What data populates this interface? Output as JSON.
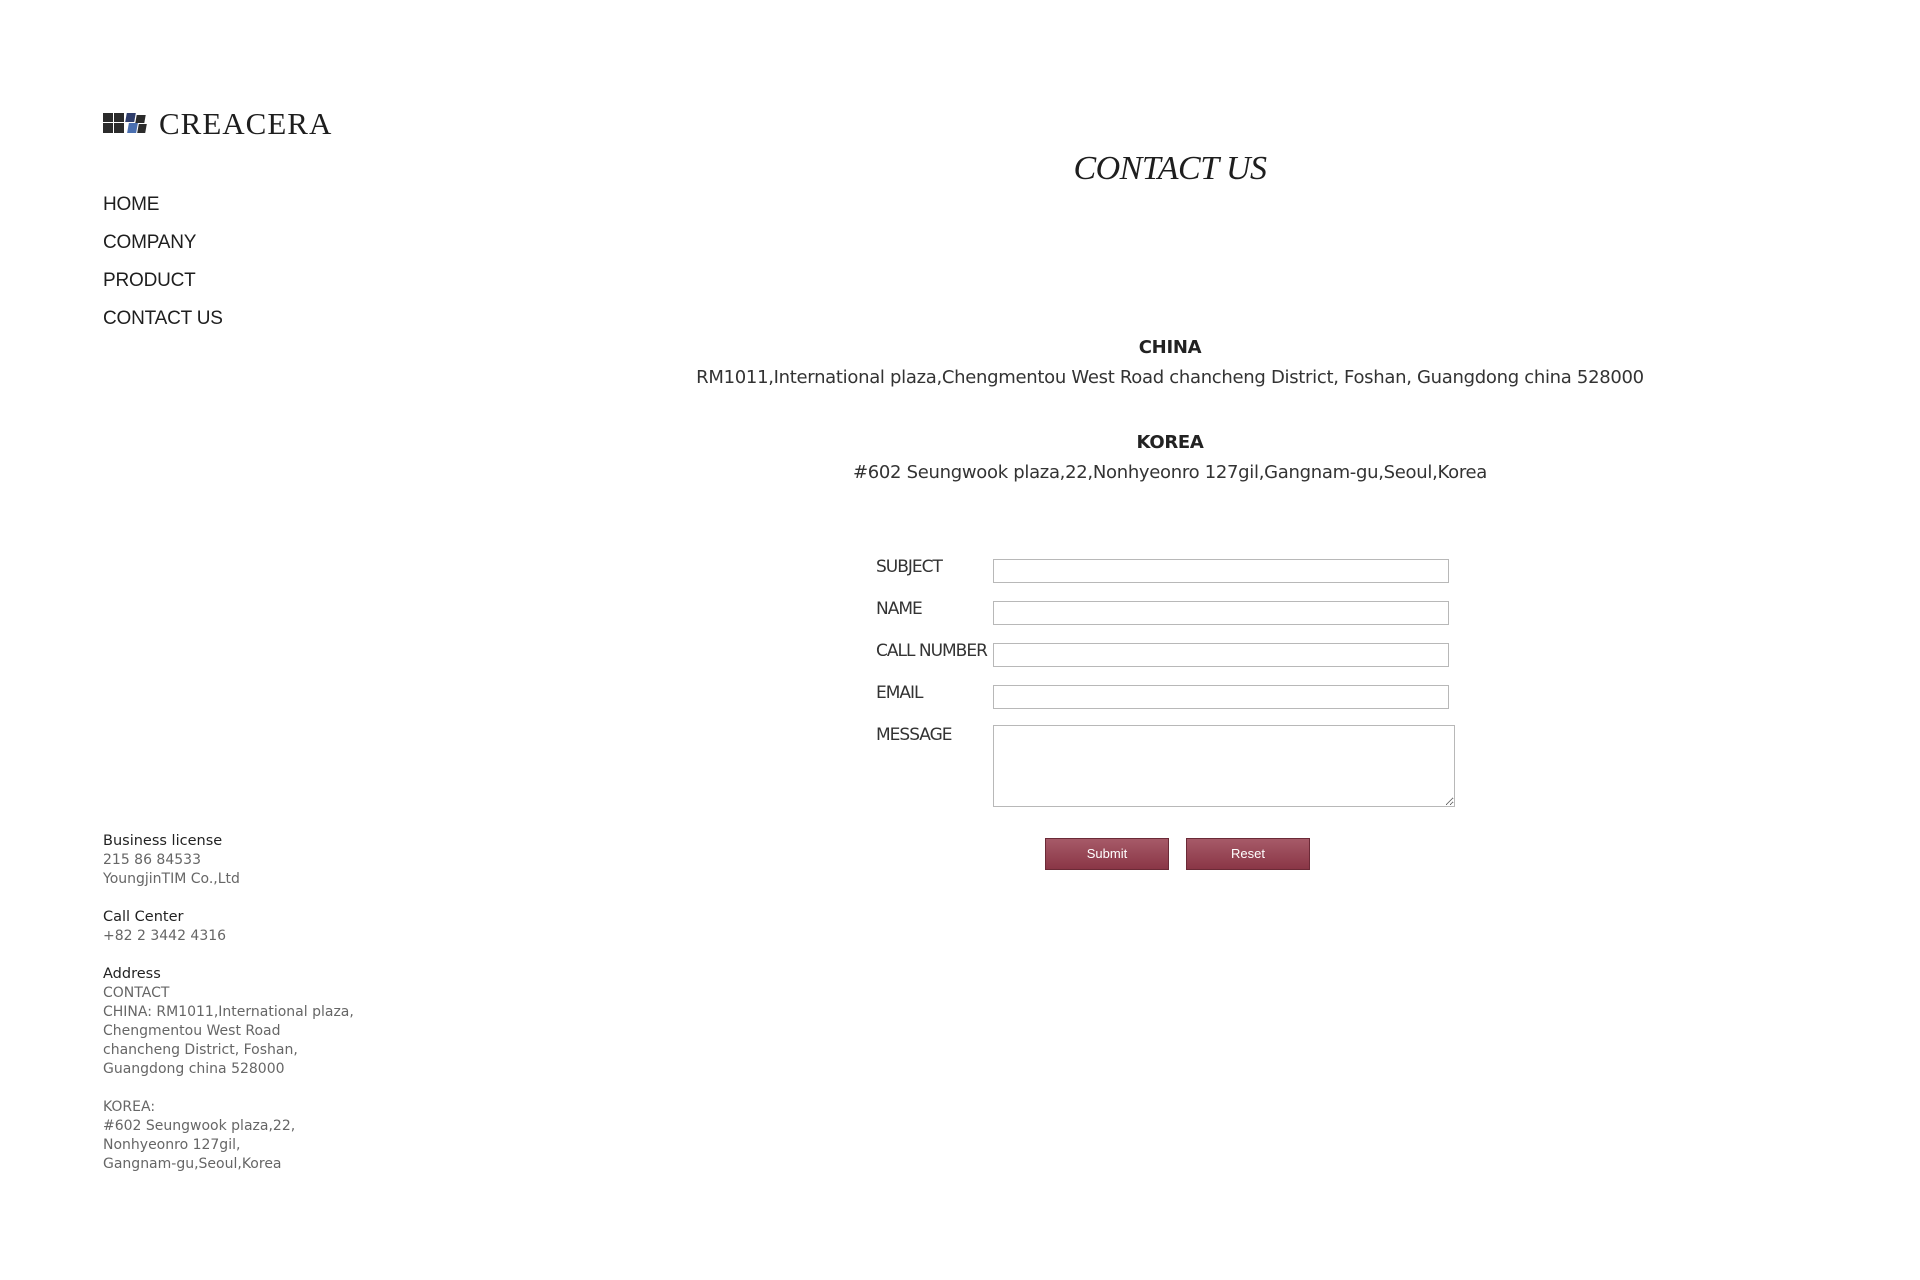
{
  "brand": {
    "name": "CREACERA",
    "logo_icon": "tile-mosaic-logo-icon"
  },
  "nav": {
    "items": [
      {
        "label": "HOME"
      },
      {
        "label": "COMPANY"
      },
      {
        "label": "PRODUCT"
      },
      {
        "label": "CONTACT US"
      }
    ]
  },
  "footer": {
    "business_license": {
      "label": "Business license",
      "lines": [
        "215 86 84533",
        "YoungjinTIM Co.,Ltd"
      ]
    },
    "call_center": {
      "label": "Call Center",
      "lines": [
        "+82 2 3442 4316"
      ]
    },
    "address": {
      "label": "Address",
      "lines": [
        "CONTACT",
        "CHINA: RM1011,International plaza,",
        "Chengmentou West Road",
        "chancheng District, Foshan,",
        "Guangdong china 528000"
      ]
    },
    "korea": {
      "lines": [
        "KOREA:",
        "#602 Seungwook plaza,22,",
        "Nonhyeonro 127gil,",
        "Gangnam-gu,Seoul,Korea"
      ]
    }
  },
  "main": {
    "title": "CONTACT US",
    "offices": [
      {
        "name": "CHINA",
        "address": "RM1011,International plaza,Chengmentou West Road chancheng District, Foshan, Guangdong china 528000"
      },
      {
        "name": "KOREA",
        "address": "#602 Seungwook plaza,22,Nonhyeonro 127gil,Gangnam-gu,Seoul,Korea"
      }
    ],
    "form": {
      "subject": {
        "label": "SUBJECT",
        "value": ""
      },
      "name": {
        "label": "NAME",
        "value": ""
      },
      "call_number": {
        "label": "CALL NUMBER",
        "value": ""
      },
      "email": {
        "label": "EMAIL",
        "value": ""
      },
      "message": {
        "label": "MESSAGE",
        "value": ""
      },
      "submit_label": "Submit",
      "reset_label": "Reset"
    }
  },
  "colors": {
    "button_bg": "#8a3646",
    "text": "#222222",
    "muted_text": "#666666"
  }
}
